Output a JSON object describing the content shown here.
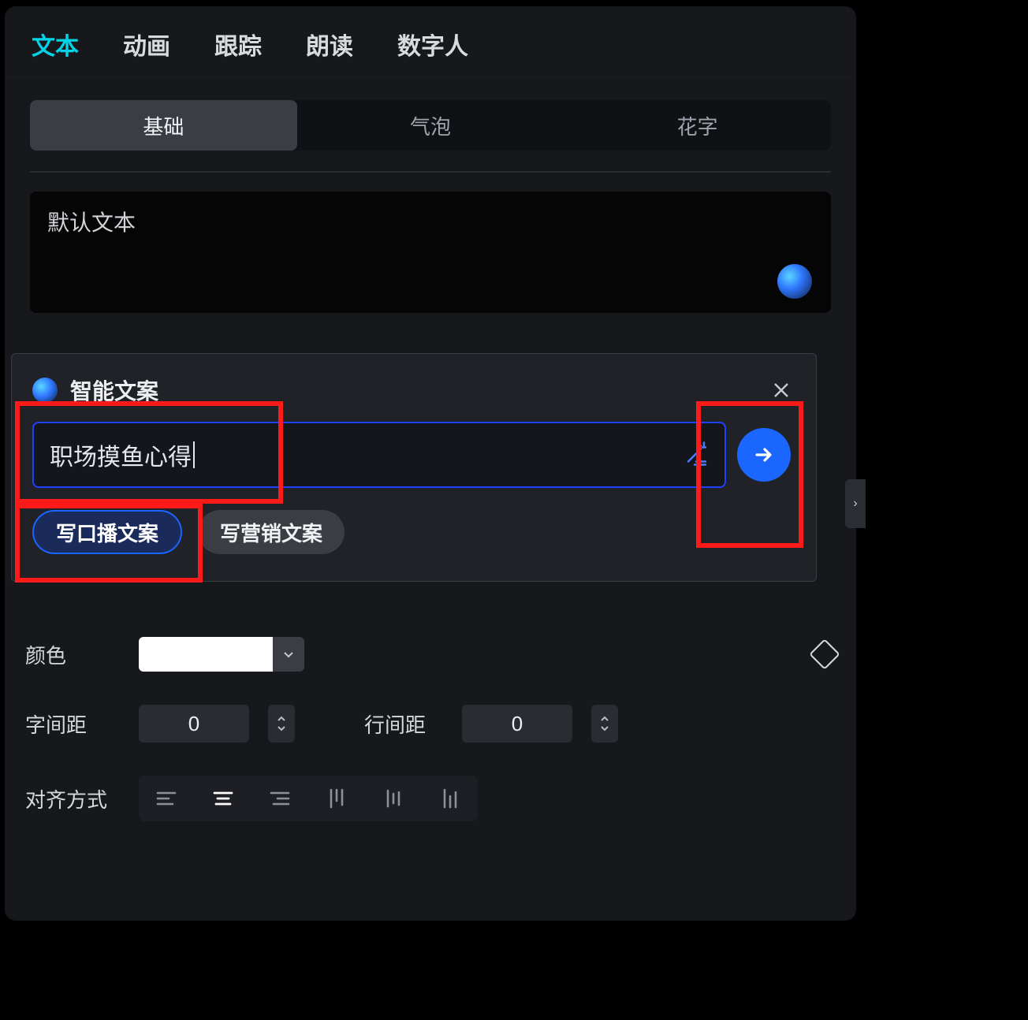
{
  "topTabs": {
    "items": [
      "文本",
      "动画",
      "跟踪",
      "朗读",
      "数字人"
    ],
    "activeIndex": 0
  },
  "subTabs": {
    "items": [
      "基础",
      "气泡",
      "花字"
    ],
    "activeIndex": 0
  },
  "textArea": {
    "value": "默认文本"
  },
  "ai": {
    "title": "智能文案",
    "inputValue": "职场摸鱼心得",
    "chips": [
      "写口播文案",
      "写营销文案"
    ],
    "activeChipIndex": 0
  },
  "props": {
    "colorLabel": "颜色",
    "colorValue": "#ffffff",
    "letterSpacingLabel": "字间距",
    "letterSpacingValue": "0",
    "lineSpacingLabel": "行间距",
    "lineSpacingValue": "0",
    "alignLabel": "对齐方式",
    "alignActiveIndex": 1
  }
}
